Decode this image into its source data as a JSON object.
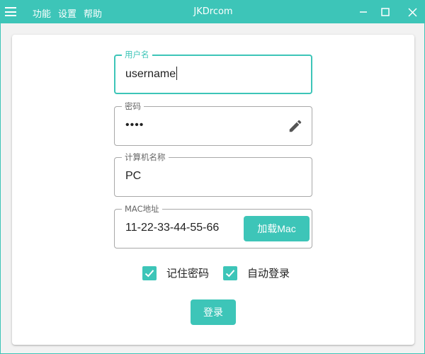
{
  "titlebar": {
    "title": "JKDrcom",
    "menus": [
      "功能",
      "设置",
      "帮助"
    ],
    "accent": "#3dc5b8"
  },
  "form": {
    "username": {
      "label": "用户名",
      "value": "username"
    },
    "password": {
      "label": "密码",
      "value": "••••",
      "icon": "edit-pencil-icon"
    },
    "hostname": {
      "label": "计算机名称",
      "value": "PC"
    },
    "mac": {
      "label": "MAC地址",
      "value": "11-22-33-44-55-66",
      "button_label": "加载Mac"
    },
    "remember_password": {
      "label": "记住密码",
      "checked": true
    },
    "auto_login": {
      "label": "自动登录",
      "checked": true
    },
    "login_label": "登录"
  }
}
